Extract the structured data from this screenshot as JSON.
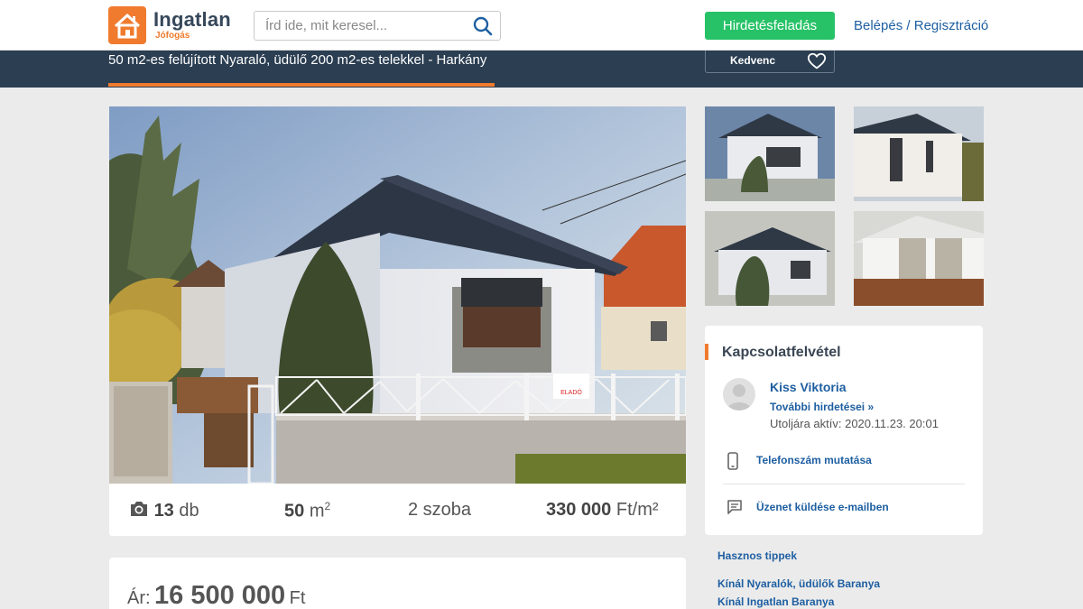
{
  "header": {
    "logo_name": "Ingatlan",
    "logo_sub": "Jófogás",
    "search_placeholder": "Írd ide, mit keresel...",
    "post_button": "Hirdetésfeladás",
    "login": "Belépés",
    "auth_separator": "/",
    "register": "Regisztráció"
  },
  "listing": {
    "title": "50 m2-es felújított Nyaraló, üdülő 200 m2-es telekkel - Harkány",
    "favorite_label": "Kedvenc",
    "sign_text": "ELADÓ"
  },
  "stats": {
    "photo_count": "13",
    "photo_unit": "db",
    "area_value": "50",
    "area_unit": "m",
    "area_exp": "2",
    "rooms": "2 szoba",
    "unit_price_value": "330 000",
    "unit_price_unit": "Ft/m²"
  },
  "price": {
    "label": "Ár:",
    "value": "16 500 000",
    "unit": "Ft"
  },
  "contact": {
    "title": "Kapcsolatfelvétel",
    "seller_name": "Kiss Viktoria",
    "more_ads": "További hirdetései »",
    "last_active": "Utoljára aktív: 2020.11.23. 20:01",
    "show_phone": "Telefonszám mutatása",
    "send_email": "Üzenet küldése e-mailben"
  },
  "links": {
    "tips": "Hasznos tippek",
    "link1": "Kínál Nyaralók, üdülők Baranya",
    "link2": "Kínál Ingatlan Baranya"
  },
  "colors": {
    "accent_orange": "#f07b2e",
    "green_button": "#27c267",
    "navy_band": "#2b3e52",
    "link_blue": "#1e5fa1"
  }
}
